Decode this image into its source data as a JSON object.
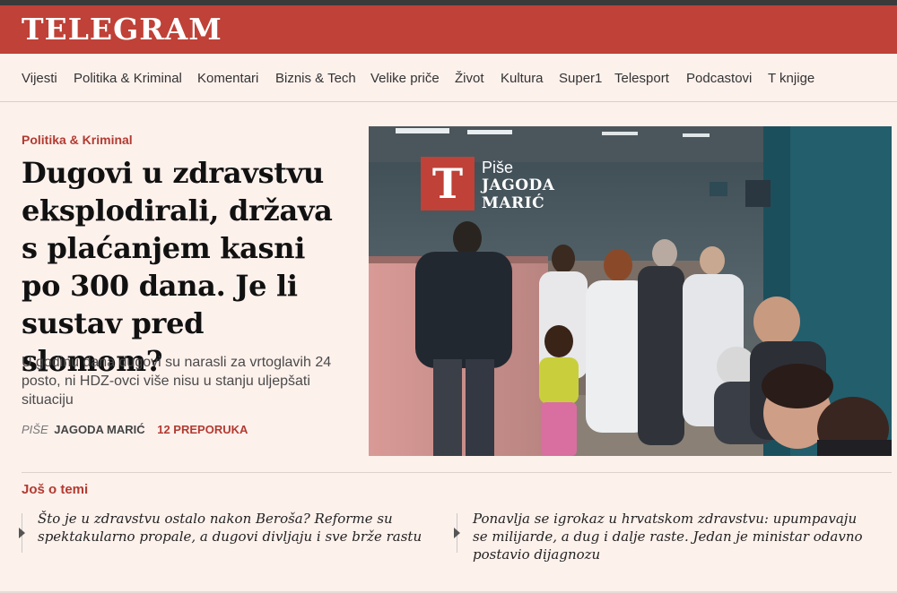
{
  "brand": {
    "logo": "TELEGRAM",
    "accent": "#bf4137"
  },
  "nav": [
    "Vijesti",
    "Politika & Kriminal",
    "Komentari",
    "Biznis & Tech",
    "Velike priče",
    "Život",
    "Kultura",
    "Super1",
    "Telesport",
    "Podcastovi",
    "T knjige"
  ],
  "article": {
    "category": "Politika & Kriminal",
    "headline": "Dugovi u zdravstvu eksplodirali, država s plaćanjem kasni po 300 dana. Je li sustav pred slomom?",
    "lead": "U godinu dana dugovi su narasli za vrtoglavih 24 posto, ni HDZ-ovci više nisu u stanju uljepšati situaciju",
    "by": "PIŠE",
    "author": "JAGODA MARIĆ",
    "recommendations": "12 PREPORUKA"
  },
  "photo_badge": {
    "letter": "T",
    "line1": "Piše",
    "line2": "JAGODA",
    "line3": "MARIĆ"
  },
  "more": {
    "title": "Još o temi",
    "items": [
      "Što je u zdravstvu ostalo nakon Beroša? Reforme su spektakularno propale, a dugovi divljaju i sve brže rastu",
      "Ponavlja se igrokaz u hrvatskom zdravstvu: upumpavaju se milijarde, a dug i dalje raste. Jedan je ministar odavno postavio dijagnozu"
    ]
  }
}
